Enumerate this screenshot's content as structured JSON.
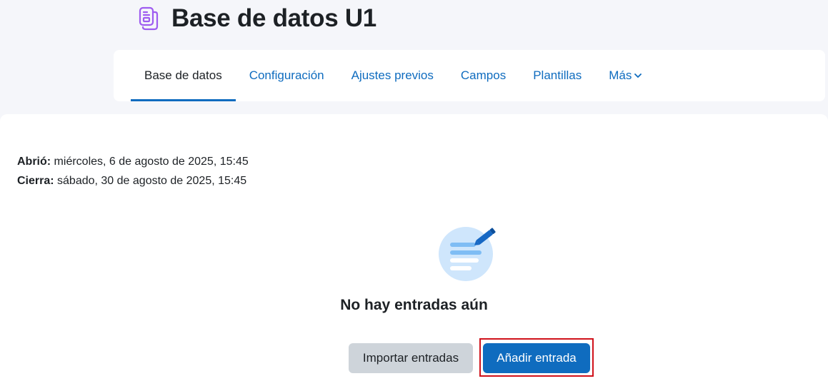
{
  "header": {
    "title": "Base de datos U1",
    "icon": "database-activity-icon",
    "icon_color": "#9e5cf0"
  },
  "tabs": [
    {
      "label": "Base de datos",
      "active": true
    },
    {
      "label": "Configuración",
      "active": false
    },
    {
      "label": "Ajustes previos",
      "active": false
    },
    {
      "label": "Campos",
      "active": false
    },
    {
      "label": "Plantillas",
      "active": false
    },
    {
      "label": "Más",
      "active": false,
      "dropdown": true
    }
  ],
  "dates": {
    "opened_label": "Abrió:",
    "opened_value": " miércoles, 6 de agosto de 2025, 15:45",
    "closes_label": "Cierra:",
    "closes_value": " sábado, 30 de agosto de 2025, 15:45"
  },
  "empty_state": {
    "message": "No hay entradas aún",
    "illustration": "empty-entries-icon"
  },
  "actions": {
    "import_label": "Importar entradas",
    "add_label": "Añadir entrada"
  },
  "colors": {
    "primary": "#0f6cbf",
    "secondary_button": "#ced4da",
    "highlight": "#d0121b"
  }
}
